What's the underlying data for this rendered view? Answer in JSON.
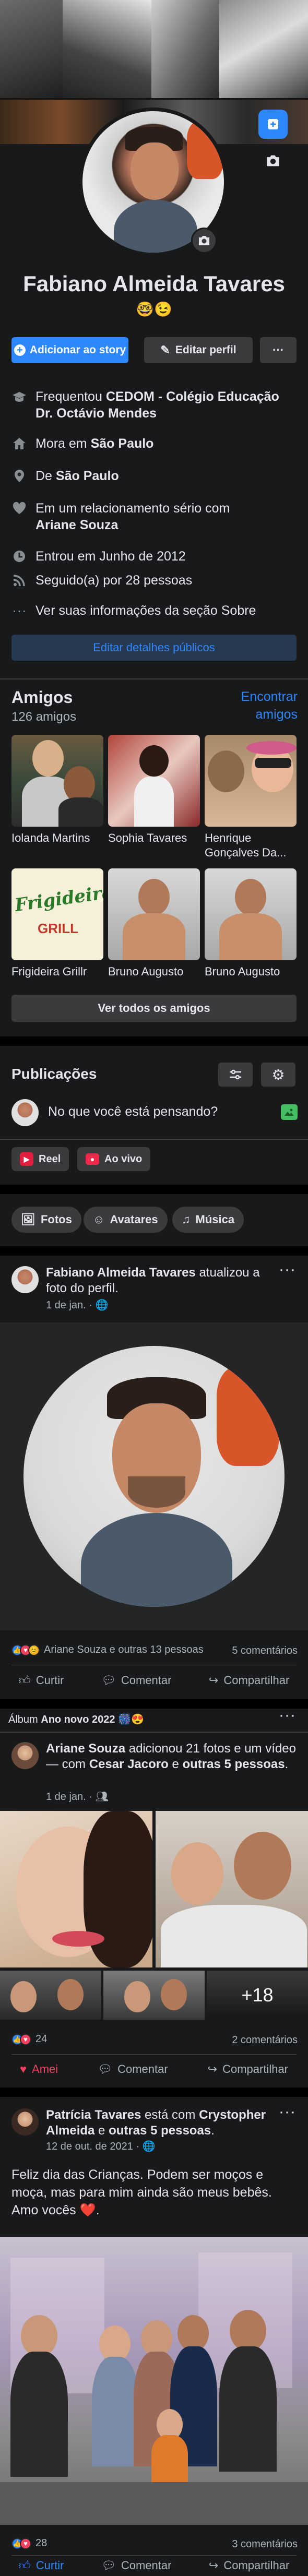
{
  "profile": {
    "name": "Fabiano Almeida Tavares",
    "emoji": "🤓😉",
    "add_story": "Adicionar ao story",
    "edit_profile": "Editar perfil",
    "more": "···"
  },
  "about": {
    "items": [
      {
        "icon": "school-icon",
        "prefix": "Frequentou ",
        "bold": "CEDOM - Colégio Educação Dr. Octávio Mendes",
        "suffix": ""
      },
      {
        "icon": "home-icon",
        "prefix": "Mora em ",
        "bold": "São Paulo",
        "suffix": ""
      },
      {
        "icon": "location-icon",
        "prefix": "De ",
        "bold": "São Paulo",
        "suffix": ""
      },
      {
        "icon": "heart-icon",
        "prefix": "Em um relacionamento sério com ",
        "bold": "Ariane Souza",
        "suffix": ""
      },
      {
        "icon": "clock-icon",
        "prefix": "Entrou em Junho de 2012",
        "bold": "",
        "suffix": ""
      },
      {
        "icon": "rss-icon",
        "prefix": "Seguido(a) por 28 pessoas",
        "bold": "",
        "suffix": ""
      },
      {
        "icon": "ellipsis-icon",
        "prefix": "Ver suas informações da seção Sobre",
        "bold": "",
        "suffix": ""
      }
    ],
    "edit_public": "Editar detalhes públicos"
  },
  "friends": {
    "title": "Amigos",
    "count": "126 amigos",
    "find": "Encontrar amigos",
    "list": [
      {
        "name": "Iolanda Martins"
      },
      {
        "name": "Sophia Tavares"
      },
      {
        "name": "Henrique Gonçalves Da..."
      },
      {
        "name": "Frigideira Grillr"
      },
      {
        "name": "Bruno Augusto"
      },
      {
        "name": "Bruno Augusto"
      }
    ],
    "see_all": "Ver todos os amigos"
  },
  "composer": {
    "title": "Publicações",
    "placeholder": "No que você está pensando?",
    "reel": "Reel",
    "live": "Ao vivo"
  },
  "chips": {
    "photos": "Fotos",
    "avatars": "Avatares",
    "music": "Música"
  },
  "post1": {
    "name": "Fabiano Almeida Tavares",
    "action": " atualizou a foto do perfil.",
    "date": "1 de jan. ·",
    "reactions": "Ariane Souza e outras 13 pessoas",
    "comments": "5 comentários",
    "like": "Curtir",
    "comment": "Comentar",
    "share": "Compartilhar"
  },
  "post2": {
    "album": "Álbum ",
    "album_name": "Ano novo 2022",
    "album_emoji": "🎆😍",
    "name": "Ariane Souza",
    "text1": " adicionou 21 fotos e um vídeo — com ",
    "with1": "Cesar Jacoro",
    "text2": " e ",
    "with2": "outras 5 pessoas",
    "text3": ".",
    "date": "1 de jan. ·",
    "more_photos": "+18",
    "reactions": "24",
    "comments": "2 comentários",
    "like": "Amei",
    "comment": "Comentar",
    "share": "Compartilhar"
  },
  "post3": {
    "name": "Patrícia Tavares",
    "text1": " está com ",
    "with1": "Crystopher Almeida",
    "text2": " e ",
    "with2": "outras 5 pessoas",
    "text3": ".",
    "date": "12 de out. de 2021 ·",
    "body": "Feliz dia das Crianças. Podem ser moços e moça, mas para mim ainda são meus bebês. Amo vocês ❤️.",
    "reactions": "28",
    "comments": "3 comentários",
    "like": "Curtir",
    "comment": "Comentar",
    "share": "Compartilhar"
  },
  "colors": {
    "bg": "#18191a",
    "card": "#242526",
    "accent": "#2d88ff",
    "button_gray": "#3a3b3c",
    "love": "#f3425f"
  }
}
